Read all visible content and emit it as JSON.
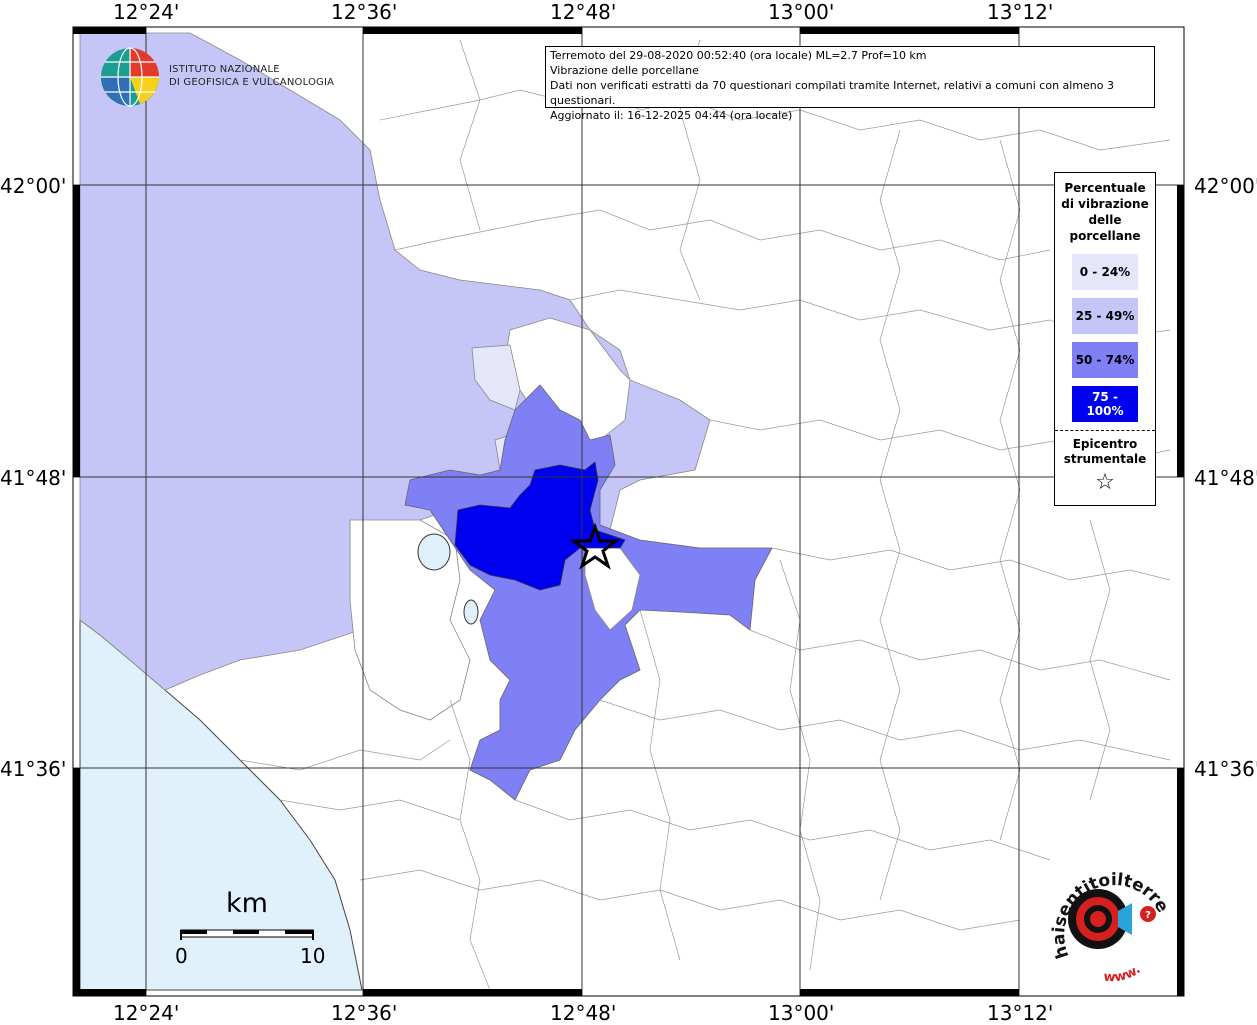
{
  "info": {
    "line1": "Terremoto del 29-08-2020 00:52:40 (ora locale) ML=2.7 Prof=10 km",
    "line2": "Vibrazione delle porcellane",
    "line3": "Dati non verificati estratti da 70 questionari compilati tramite Internet, relativi a comuni con almeno 3 questionari.",
    "line4": "Aggiornato il: 16-12-2025 04:44 (ora locale)"
  },
  "coords": {
    "lon": [
      "12°24'",
      "12°36'",
      "12°48'",
      "13°00'",
      "13°12'"
    ],
    "lat": [
      "42°00'",
      "41°48'",
      "41°36'"
    ]
  },
  "logo": {
    "line1": "ISTITUTO NAZIONALE",
    "line2": "DI GEOFISICA E VULCANOLOGIA"
  },
  "legend": {
    "title_lines": [
      "Percentuale",
      "di vibrazione",
      "delle",
      "porcellane"
    ],
    "classes": [
      {
        "label": "0 - 24%",
        "color": "#e6e6fa",
        "text_color": "#000000"
      },
      {
        "label": "25 - 49%",
        "color": "#c5c5f7",
        "text_color": "#000000"
      },
      {
        "label": "50 - 74%",
        "color": "#7f7ff6",
        "text_color": "#000000"
      },
      {
        "label": "75 - 100%",
        "color": "#0000f0",
        "text_color": "#ffffff"
      }
    ],
    "epicenter_lines": [
      "Epicentro",
      "strumentale"
    ],
    "epicenter_icon": "star-outline-icon"
  },
  "scale": {
    "unit": "km",
    "start": "0",
    "end": "10"
  },
  "brand": {
    "text": "haisentitoilterremoto.it",
    "prefix": "www."
  },
  "colors": {
    "sea": "#e1f1fc",
    "class_0_24": "#e6e6fa",
    "class_25_49": "#c5c5f7",
    "class_50_74": "#7f7ff6",
    "class_75_100": "#0000f0"
  }
}
